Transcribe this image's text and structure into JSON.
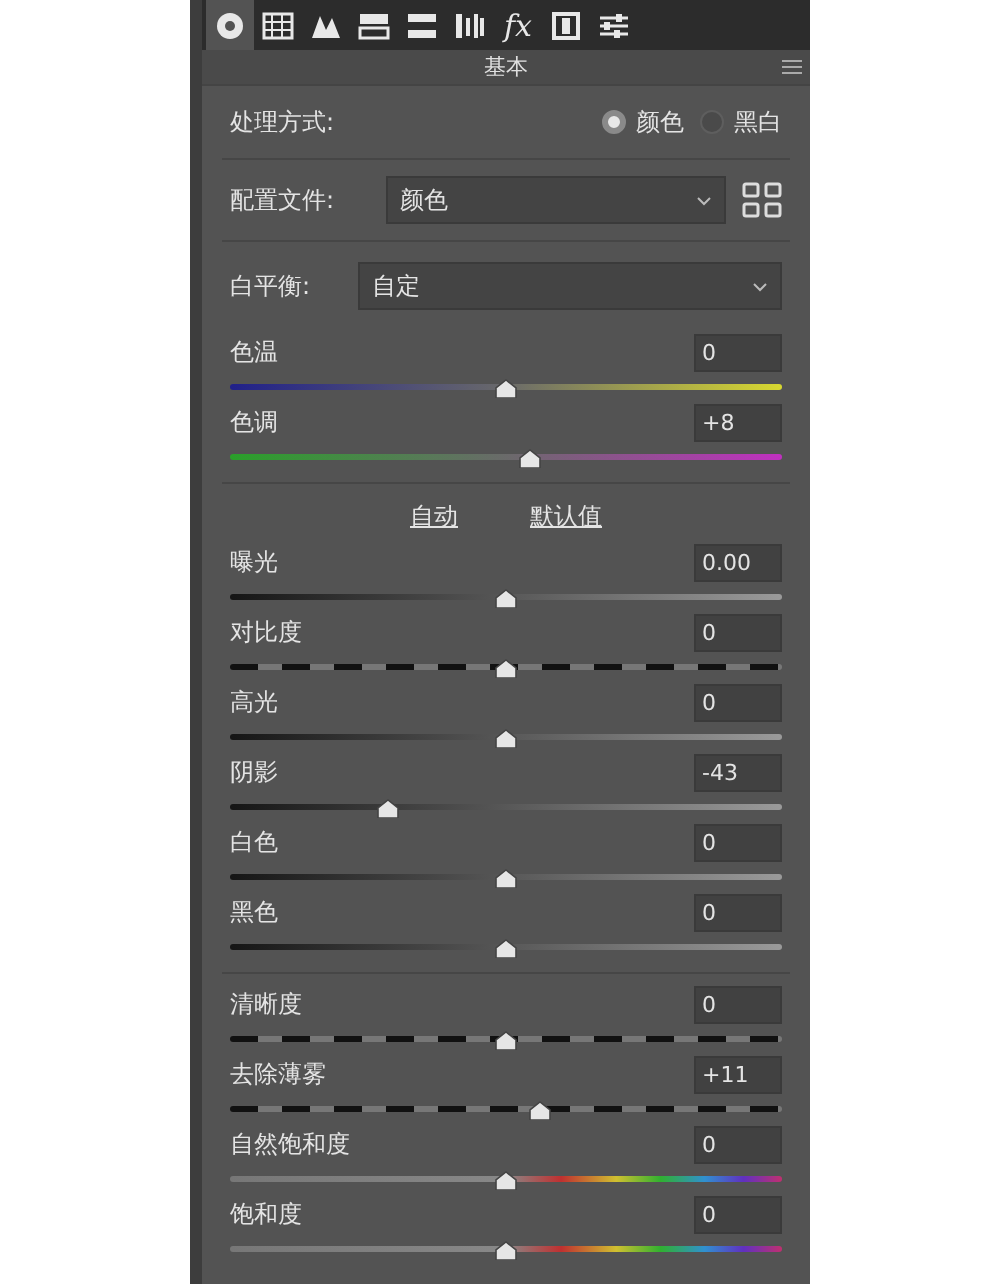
{
  "toolbar": {
    "tabs": [
      {
        "kind": "aperture",
        "selected": true
      },
      {
        "kind": "grid",
        "selected": false
      },
      {
        "kind": "peaks",
        "selected": false
      },
      {
        "kind": "split",
        "selected": false
      },
      {
        "kind": "bars",
        "selected": false
      },
      {
        "kind": "columns",
        "selected": false
      },
      {
        "kind": "text",
        "label": "fx",
        "selected": false
      },
      {
        "kind": "film",
        "selected": false
      },
      {
        "kind": "sliders",
        "selected": false
      }
    ]
  },
  "panel": {
    "title": "基本"
  },
  "treatment": {
    "label": "处理方式:",
    "options": [
      {
        "label": "颜色",
        "selected": true
      },
      {
        "label": "黑白",
        "selected": false
      }
    ]
  },
  "profile": {
    "label": "配置文件:",
    "value": "颜色"
  },
  "white_balance": {
    "label": "白平衡:",
    "value": "自定"
  },
  "groups": [
    {
      "sliders": [
        {
          "label": "色温",
          "value": "0",
          "kind": "temperature",
          "level": 0.5
        },
        {
          "label": "色调",
          "value": "+8",
          "kind": "tint",
          "level": 0.545
        }
      ]
    },
    {
      "links": [
        "自动",
        "默认值"
      ],
      "sliders": [
        {
          "label": "曝光",
          "value": "0.00",
          "kind": "plain",
          "level": 0.5
        },
        {
          "label": "对比度",
          "value": "0",
          "kind": "dashed",
          "level": 0.5
        },
        {
          "label": "高光",
          "value": "0",
          "kind": "plain",
          "level": 0.5
        },
        {
          "label": "阴影",
          "value": "-43",
          "kind": "plain",
          "level": 0.285
        },
        {
          "label": "白色",
          "value": "0",
          "kind": "plain",
          "level": 0.5
        },
        {
          "label": "黑色",
          "value": "0",
          "kind": "plain",
          "level": 0.5
        }
      ]
    },
    {
      "sliders": [
        {
          "label": "清晰度",
          "value": "0",
          "kind": "dashed",
          "level": 0.5
        },
        {
          "label": "去除薄雾",
          "value": "+11",
          "kind": "dashed",
          "level": 0.56
        },
        {
          "label": "自然饱和度",
          "value": "0",
          "kind": "spectrum",
          "level": 0.5
        },
        {
          "label": "饱和度",
          "value": "0",
          "kind": "spectrum",
          "level": 0.5
        }
      ]
    }
  ]
}
